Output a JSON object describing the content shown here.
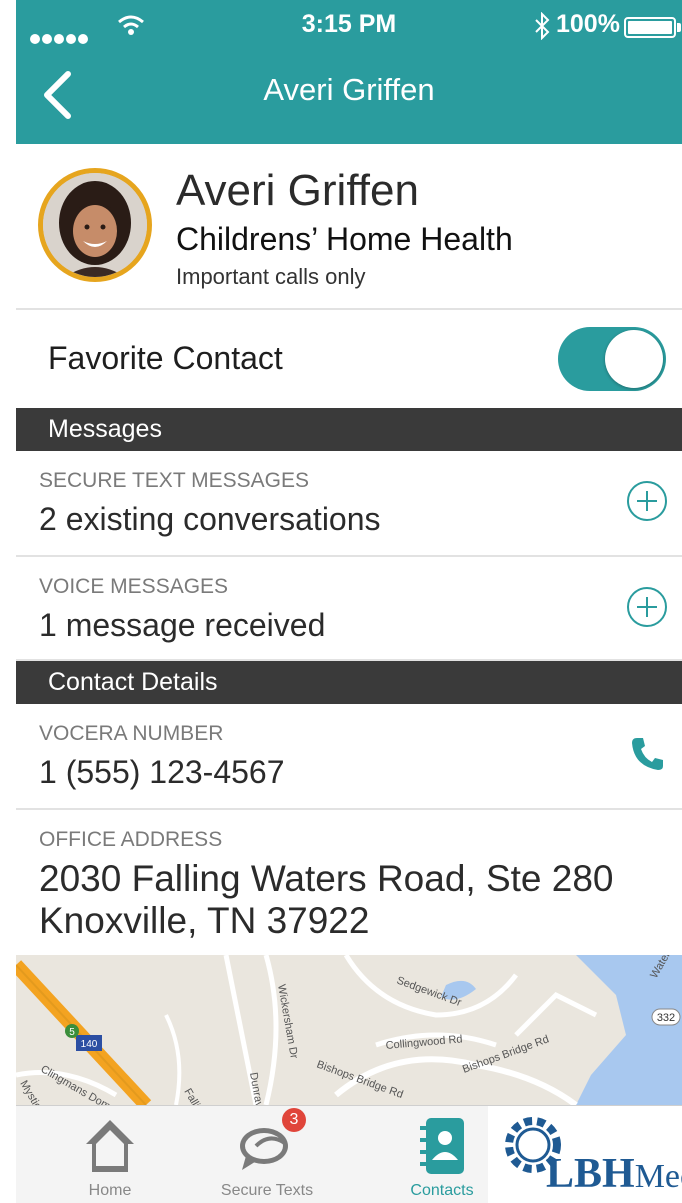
{
  "status_bar": {
    "time": "3:15 PM",
    "battery": "100%"
  },
  "nav": {
    "title": "Averi Griffen"
  },
  "profile": {
    "name": "Averi Griffen",
    "organization": "Childrens’ Home Health",
    "note": "Important calls only"
  },
  "favorite": {
    "label": "Favorite Contact",
    "enabled": true
  },
  "sections": {
    "messages": "Messages",
    "contact_details": "Contact Details"
  },
  "messages": {
    "secure_text": {
      "label": "SECURE TEXT MESSAGES",
      "value": "2 existing conversations"
    },
    "voice": {
      "label": "VOICE MESSAGES",
      "value": "1 message received"
    }
  },
  "details": {
    "vocera": {
      "label": "VOCERA NUMBER",
      "value": "1 (555) 123-4567"
    },
    "office": {
      "label": "OFFICE ADDRESS",
      "line1": "2030 Falling Waters Road, Ste 280",
      "line2": "Knoxville, TN 37922"
    }
  },
  "map": {
    "labels": [
      "Sedgewick Dr",
      "Collingwood Rd",
      "Bishops Bridge Rd",
      "Bishops Bridge Rd",
      "Wickersham Dr",
      "Dunraven",
      "Clingmans Dome Dr",
      "Mystic St",
      "Fallin",
      "Water",
      "332",
      "140",
      "5"
    ]
  },
  "tabs": [
    {
      "label": "Home",
      "icon": "home-icon"
    },
    {
      "label": "Secure Texts",
      "icon": "chat-bubbles-icon",
      "badge": "3"
    },
    {
      "label": "Contacts",
      "icon": "contacts-icon"
    }
  ],
  "logo": {
    "text": "LBH",
    "tail": "Mec"
  },
  "colors": {
    "teal": "#2a9c9e",
    "section": "#3a3a3a",
    "avatar_ring": "#e6a51e",
    "badge": "#e0453a",
    "logo": "#1f5a93"
  }
}
